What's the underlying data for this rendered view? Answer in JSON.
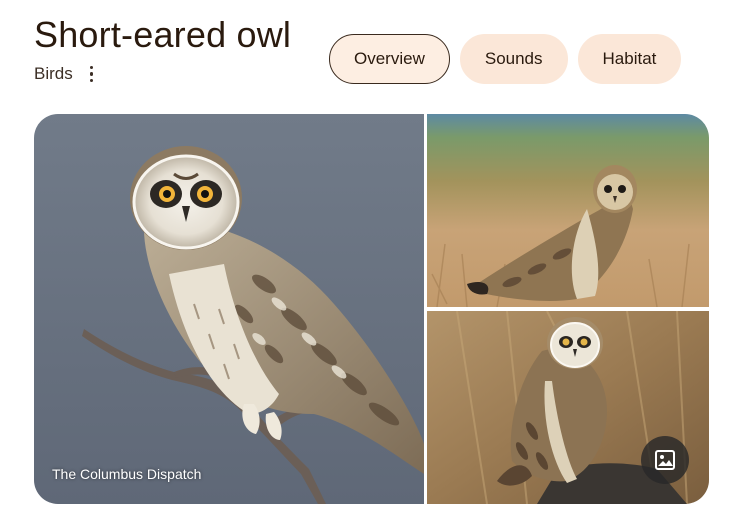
{
  "header": {
    "title": "Short-eared owl",
    "subtitle": "Birds",
    "more_icon": "more-vert-icon"
  },
  "tabs": [
    {
      "label": "Overview",
      "active": true
    },
    {
      "label": "Sounds",
      "active": false
    },
    {
      "label": "Habitat",
      "active": false
    }
  ],
  "gallery": {
    "credit": "The Columbus Dispatch",
    "view_images_icon": "image-icon"
  },
  "colors": {
    "tab_background": "#fbe7d8",
    "title_text": "#2a1a0e",
    "main_photo_sky": "#6e7886"
  }
}
